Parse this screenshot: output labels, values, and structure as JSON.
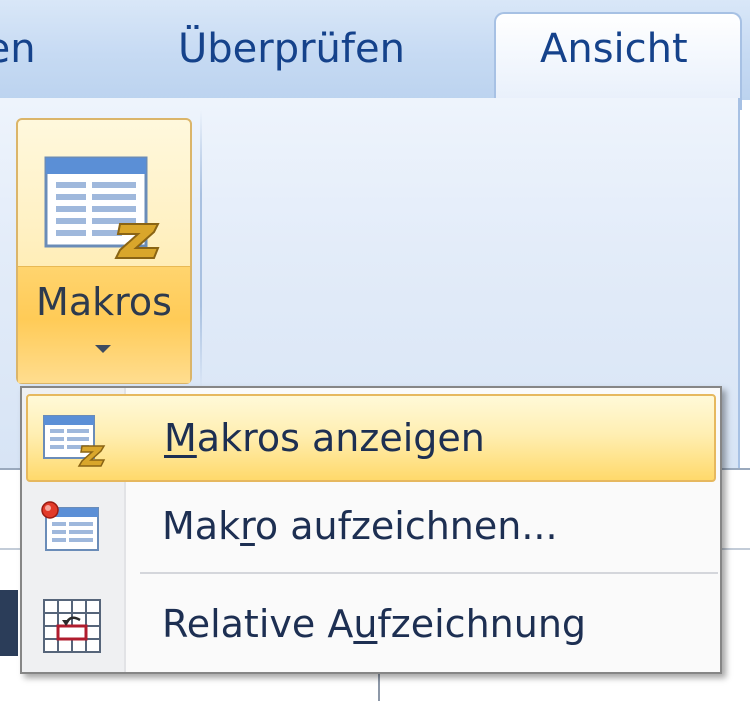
{
  "tabs": [
    {
      "label": "ten"
    },
    {
      "label": "Überprüfen"
    },
    {
      "label": "Ansicht",
      "active": true
    }
  ],
  "ribbon": {
    "macros_button": {
      "label": "Makros",
      "icon": "macro-table-icon",
      "has_dropdown": true
    }
  },
  "menu": {
    "items": [
      {
        "label_pre": "",
        "label_key": "M",
        "label_post": "akros anzeigen",
        "icon": "view-macros-icon",
        "highlighted": true
      },
      {
        "label_pre": "Mak",
        "label_key": "r",
        "label_post": "o aufzeichnen...",
        "icon": "record-macro-icon",
        "highlighted": false
      },
      {
        "label_pre": "Relative A",
        "label_key": "u",
        "label_post": "fzeichnung",
        "icon": "relative-reference-icon",
        "highlighted": false
      }
    ]
  },
  "colors": {
    "tab_text": "#15428b",
    "ribbon_bg": "#dfe9f8",
    "highlight": "#ffd96b",
    "menu_text": "#1d2f52"
  }
}
